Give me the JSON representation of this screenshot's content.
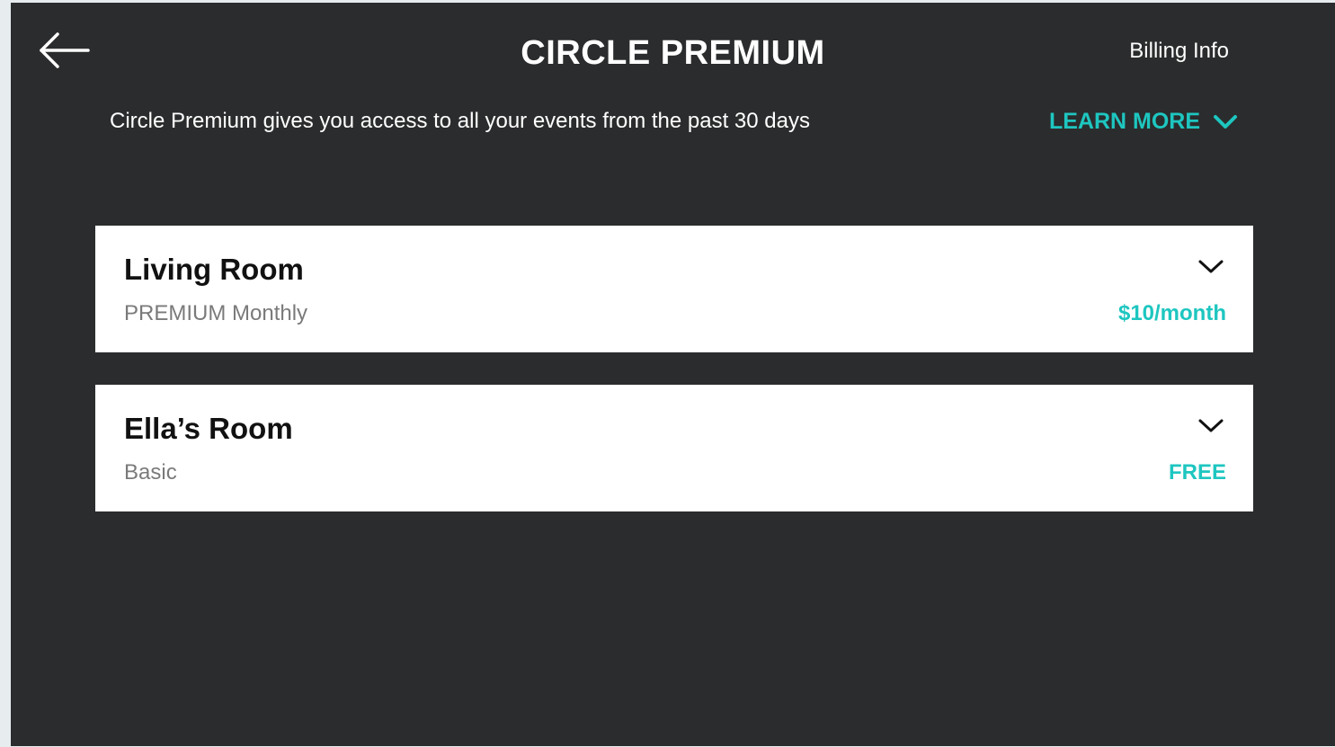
{
  "header": {
    "back_icon": "arrow-left-icon",
    "title": "CIRCLE PREMIUM",
    "billing_label": "Billing Info"
  },
  "info": {
    "description": "Circle Premium gives you access to all your events from the past 30 days",
    "learn_more_label": "LEARN MORE",
    "learn_more_icon": "chevron-down-icon"
  },
  "devices": [
    {
      "name": "Living Room",
      "plan": "PREMIUM Monthly",
      "price": "$10/month",
      "icon": "chevron-down-icon"
    },
    {
      "name": "Ella’s Room",
      "plan": "Basic",
      "price": "FREE",
      "icon": "chevron-down-icon"
    }
  ],
  "colors": {
    "background": "#2b2c2d",
    "accent": "#1ec6c0",
    "card": "#ffffff"
  }
}
